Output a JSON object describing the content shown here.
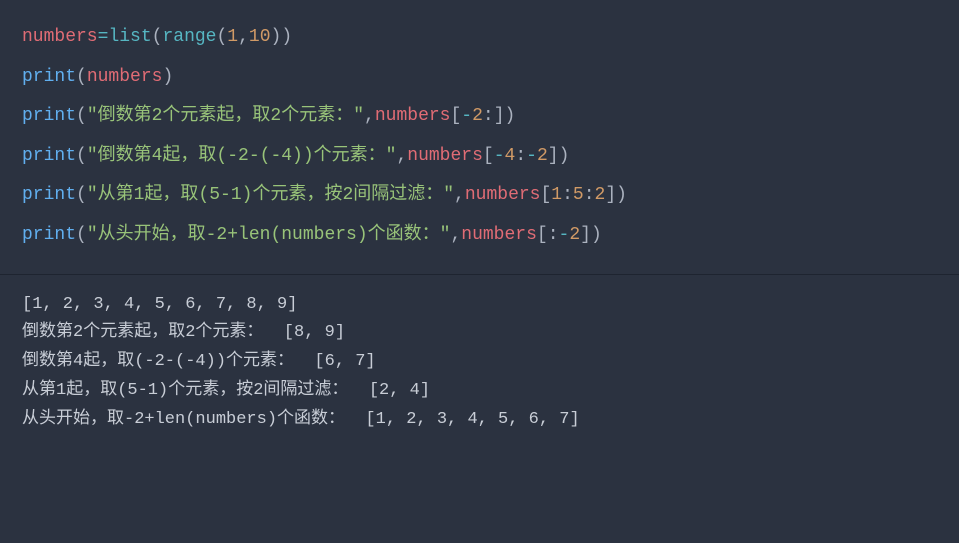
{
  "code": {
    "lines": [
      {
        "tokens": [
          {
            "t": "numbers",
            "c": "tok-id"
          },
          {
            "t": "=",
            "c": "tok-op"
          },
          {
            "t": "list",
            "c": "tok-builtin"
          },
          {
            "t": "(",
            "c": "tok-paren"
          },
          {
            "t": "range",
            "c": "tok-builtin"
          },
          {
            "t": "(",
            "c": "tok-paren"
          },
          {
            "t": "1",
            "c": "tok-num"
          },
          {
            "t": ",",
            "c": "tok-punc"
          },
          {
            "t": "10",
            "c": "tok-num"
          },
          {
            "t": "))",
            "c": "tok-paren"
          }
        ]
      },
      {
        "tokens": [
          {
            "t": "print",
            "c": "tok-func"
          },
          {
            "t": "(",
            "c": "tok-paren"
          },
          {
            "t": "numbers",
            "c": "tok-id"
          },
          {
            "t": ")",
            "c": "tok-paren"
          }
        ]
      },
      {
        "tokens": [
          {
            "t": "print",
            "c": "tok-func"
          },
          {
            "t": "(",
            "c": "tok-paren"
          },
          {
            "t": "\"倒数第2个元素起，取2个元素：\"",
            "c": "tok-str"
          },
          {
            "t": ",",
            "c": "tok-punc"
          },
          {
            "t": "numbers",
            "c": "tok-id"
          },
          {
            "t": "[",
            "c": "tok-paren"
          },
          {
            "t": "-",
            "c": "tok-op"
          },
          {
            "t": "2",
            "c": "tok-num"
          },
          {
            "t": ":",
            "c": "tok-punc"
          },
          {
            "t": "])",
            "c": "tok-paren"
          }
        ]
      },
      {
        "tokens": [
          {
            "t": "print",
            "c": "tok-func"
          },
          {
            "t": "(",
            "c": "tok-paren"
          },
          {
            "t": "\"倒数第4起，取(-2-(-4))个元素：\"",
            "c": "tok-str"
          },
          {
            "t": ",",
            "c": "tok-punc"
          },
          {
            "t": "numbers",
            "c": "tok-id"
          },
          {
            "t": "[",
            "c": "tok-paren"
          },
          {
            "t": "-",
            "c": "tok-op"
          },
          {
            "t": "4",
            "c": "tok-num"
          },
          {
            "t": ":",
            "c": "tok-punc"
          },
          {
            "t": "-",
            "c": "tok-op"
          },
          {
            "t": "2",
            "c": "tok-num"
          },
          {
            "t": "])",
            "c": "tok-paren"
          }
        ]
      },
      {
        "tokens": [
          {
            "t": "print",
            "c": "tok-func"
          },
          {
            "t": "(",
            "c": "tok-paren"
          },
          {
            "t": "\"从第1起，取(5-1)个元素，按2间隔过滤：\"",
            "c": "tok-str"
          },
          {
            "t": ",",
            "c": "tok-punc"
          },
          {
            "t": "numbers",
            "c": "tok-id"
          },
          {
            "t": "[",
            "c": "tok-paren"
          },
          {
            "t": "1",
            "c": "tok-num"
          },
          {
            "t": ":",
            "c": "tok-punc"
          },
          {
            "t": "5",
            "c": "tok-num"
          },
          {
            "t": ":",
            "c": "tok-punc"
          },
          {
            "t": "2",
            "c": "tok-num"
          },
          {
            "t": "])",
            "c": "tok-paren"
          }
        ]
      },
      {
        "tokens": [
          {
            "t": "print",
            "c": "tok-func"
          },
          {
            "t": "(",
            "c": "tok-paren"
          },
          {
            "t": "\"从头开始，取-2+len(numbers)个函数：\"",
            "c": "tok-str"
          },
          {
            "t": ",",
            "c": "tok-punc"
          },
          {
            "t": "numbers",
            "c": "tok-id"
          },
          {
            "t": "[:",
            "c": "tok-paren"
          },
          {
            "t": "-",
            "c": "tok-op"
          },
          {
            "t": "2",
            "c": "tok-num"
          },
          {
            "t": "])",
            "c": "tok-paren"
          }
        ]
      }
    ]
  },
  "output": {
    "lines": [
      "[1, 2, 3, 4, 5, 6, 7, 8, 9]",
      "倒数第2个元素起，取2个元素：  [8, 9]",
      "倒数第4起，取(-2-(-4))个元素：  [6, 7]",
      "从第1起，取(5-1)个元素，按2间隔过滤：  [2, 4]",
      "从头开始，取-2+len(numbers)个函数：  [1, 2, 3, 4, 5, 6, 7]"
    ]
  }
}
